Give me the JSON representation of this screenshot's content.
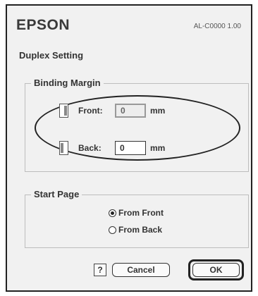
{
  "header": {
    "brand": "EPSON",
    "model_version": "AL-C0000 1.00"
  },
  "title": "Duplex Setting",
  "binding_margin": {
    "label": "Binding Margin",
    "front": {
      "label": "Front:",
      "value": "0",
      "unit": "mm",
      "enabled": false
    },
    "back": {
      "label": "Back:",
      "value": "0",
      "unit": "mm",
      "enabled": true
    }
  },
  "start_page": {
    "label": "Start Page",
    "options": [
      {
        "label": "From Front",
        "selected": true
      },
      {
        "label": "From Back",
        "selected": false
      }
    ]
  },
  "buttons": {
    "help": "?",
    "cancel": "Cancel",
    "ok": "OK"
  }
}
